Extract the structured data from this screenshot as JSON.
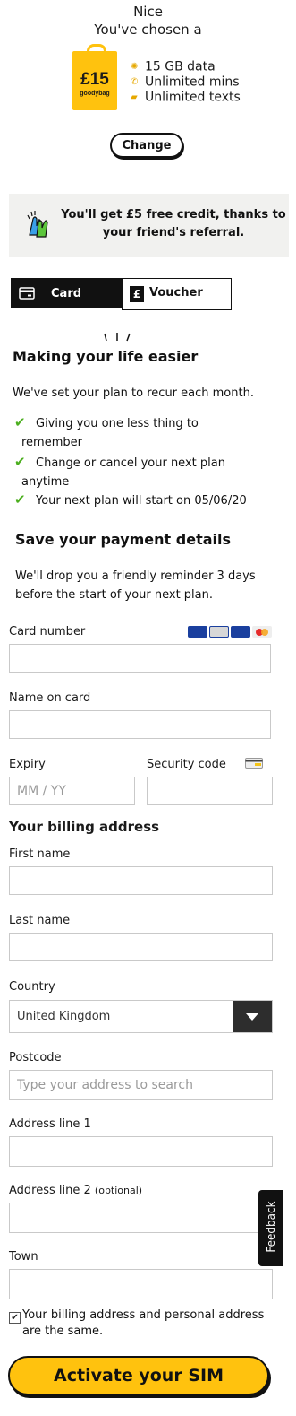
{
  "header": {
    "greeting": "Nice",
    "chosen": "You've chosen a"
  },
  "plan": {
    "price": "£15",
    "brand": "goodybag",
    "features": [
      {
        "icon": "data-icon",
        "text": "15 GB data"
      },
      {
        "icon": "phone-icon",
        "text": "Unlimited mins"
      },
      {
        "icon": "message-icon",
        "text": "Unlimited texts"
      }
    ],
    "change_label": "Change"
  },
  "referral": {
    "line1": "You'll get £5 free credit, thanks to",
    "line2": "your friend's referral."
  },
  "payment_tabs": {
    "card": "Card",
    "voucher": "Voucher",
    "voucher_symbol": "£"
  },
  "easier": {
    "title": "Making your life easier",
    "intro": "We've set your plan to recur each month.",
    "benefits": [
      {
        "line1": "Giving you one less thing to",
        "line2": "remember"
      },
      {
        "line1": "Change or cancel your next plan",
        "line2": "anytime"
      },
      {
        "line1": "Your next plan will start on 05/06/20",
        "line2": ""
      }
    ]
  },
  "save": {
    "title": "Save your payment details",
    "line1": "We'll drop you a friendly reminder 3 days",
    "line2": "before the start of your next plan."
  },
  "form": {
    "card_number_label": "Card number",
    "card_brands": [
      "VISA",
      "Maestro",
      "VISA Electron",
      "Mastercard"
    ],
    "name_label": "Name on card",
    "expiry_label": "Expiry",
    "expiry_placeholder": "MM / YY",
    "security_label": "Security code",
    "billing_title": "Your billing address",
    "first_name_label": "First name",
    "last_name_label": "Last name",
    "country_label": "Country",
    "country_value": "United Kingdom",
    "postcode_label": "Postcode",
    "postcode_placeholder": "Type your address to search",
    "address1_label": "Address line 1",
    "address2_label": "Address line 2",
    "address2_optional": "(optional)",
    "town_label": "Town",
    "same_address_line1": "Your billing address and personal address",
    "same_address_line2": "are the same.",
    "same_address_checked": true
  },
  "feedback_label": "Feedback",
  "activate_label": "Activate your SIM",
  "colors": {
    "accent": "#ffc20e",
    "check": "#4caf1f",
    "dark": "#111111"
  }
}
